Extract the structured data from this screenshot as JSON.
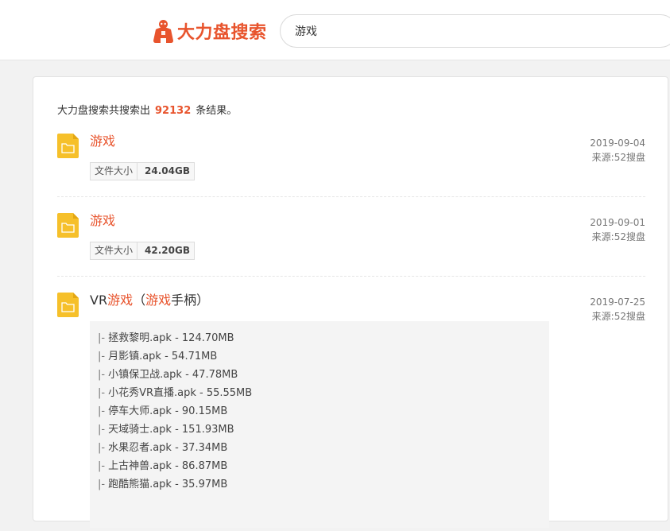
{
  "brand": {
    "name": "大力盘搜索"
  },
  "search": {
    "value": "游戏"
  },
  "summary": {
    "prefix": "大力盘搜索共搜索出",
    "count": "92132",
    "suffix": "条结果。"
  },
  "colors": {
    "accent": "#e8542d",
    "folder": "#f6c02a"
  },
  "icons": {
    "logo": "gorilla-logo-icon",
    "result": "folder-icon"
  },
  "results": [
    {
      "title_parts": [
        {
          "text": "游戏",
          "highlight": true
        }
      ],
      "date": "2019-09-04",
      "source": "来源:52搜盘",
      "size_label": "文件大小",
      "size_value": "24.04GB"
    },
    {
      "title_parts": [
        {
          "text": "游戏",
          "highlight": true
        }
      ],
      "date": "2019-09-01",
      "source": "来源:52搜盘",
      "size_label": "文件大小",
      "size_value": "42.20GB"
    },
    {
      "title_parts": [
        {
          "text": "VR",
          "highlight": false
        },
        {
          "text": "游戏",
          "highlight": true
        },
        {
          "text": "（",
          "highlight": false
        },
        {
          "text": "游戏",
          "highlight": true
        },
        {
          "text": "手柄）",
          "highlight": false
        }
      ],
      "date": "2019-07-25",
      "source": "来源:52搜盘",
      "files_prefix": "|-",
      "files": [
        "拯救黎明.apk - 124.70MB",
        "月影镇.apk - 54.71MB",
        "小镇保卫战.apk - 47.78MB",
        "小花秀VR直播.apk - 55.55MB",
        "停车大师.apk - 90.15MB",
        "天域骑士.apk - 151.93MB",
        "水果忍者.apk - 37.34MB",
        "上古神兽.apk - 86.87MB",
        "跑酷熊猫.apk - 35.97MB"
      ]
    }
  ]
}
